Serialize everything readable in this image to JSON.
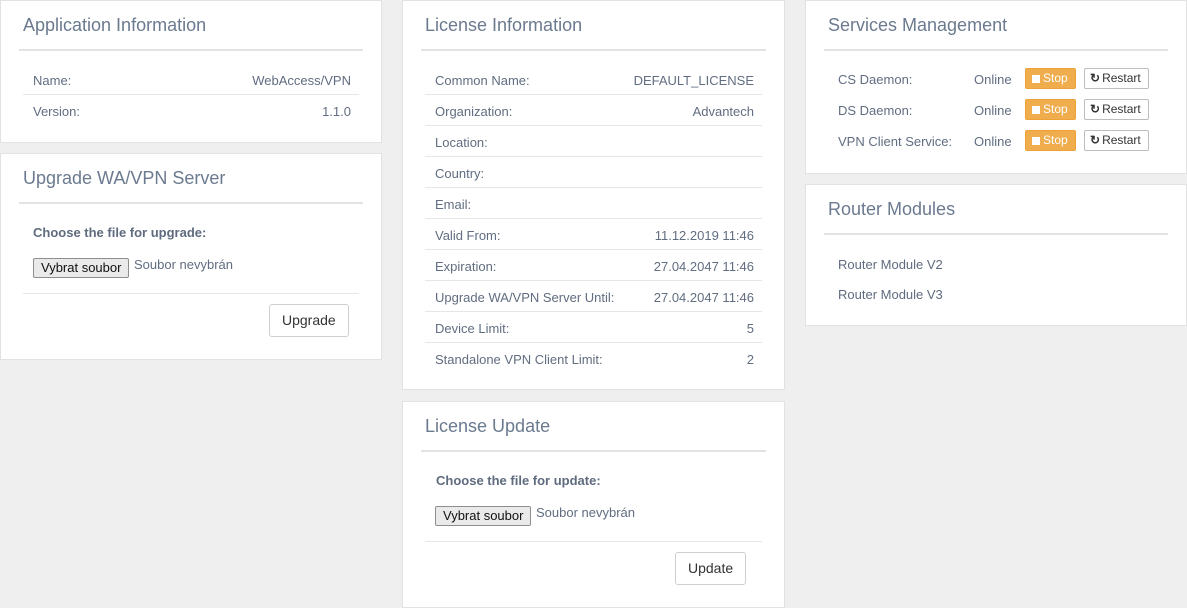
{
  "app_info": {
    "title": "Application Information",
    "rows": [
      {
        "label": "Name:",
        "value": "WebAccess/VPN"
      },
      {
        "label": "Version:",
        "value": "1.1.0"
      }
    ]
  },
  "upgrade": {
    "title": "Upgrade WA/VPN Server",
    "choose_label": "Choose the file for upgrade:",
    "file_button": "Vybrat soubor",
    "file_status": "Soubor nevybrán",
    "action_button": "Upgrade"
  },
  "license_info": {
    "title": "License Information",
    "rows": [
      {
        "label": "Common Name:",
        "value": "DEFAULT_LICENSE"
      },
      {
        "label": "Organization:",
        "value": "Advantech"
      },
      {
        "label": "Location:",
        "value": ""
      },
      {
        "label": "Country:",
        "value": ""
      },
      {
        "label": "Email:",
        "value": ""
      },
      {
        "label": "Valid From:",
        "value": "11.12.2019 11:46"
      },
      {
        "label": "Expiration:",
        "value": "27.04.2047 11:46"
      },
      {
        "label": "Upgrade WA/VPN Server Until:",
        "value": "27.04.2047 11:46"
      },
      {
        "label": "Device Limit:",
        "value": "5"
      },
      {
        "label": "Standalone VPN Client Limit:",
        "value": "2"
      }
    ]
  },
  "license_update": {
    "title": "License Update",
    "choose_label": "Choose the file for update:",
    "file_button": "Vybrat soubor",
    "file_status": "Soubor nevybrán",
    "action_button": "Update"
  },
  "services": {
    "title": "Services Management",
    "stop_label": "Stop",
    "restart_label": "Restart",
    "stop_color": "#f0ad4e",
    "items": [
      {
        "name": "CS Daemon:",
        "status": "Online"
      },
      {
        "name": "DS Daemon:",
        "status": "Online"
      },
      {
        "name": "VPN Client Service:",
        "status": "Online"
      }
    ]
  },
  "router_modules": {
    "title": "Router Modules",
    "items": [
      "Router Module V2",
      "Router Module V3"
    ]
  }
}
